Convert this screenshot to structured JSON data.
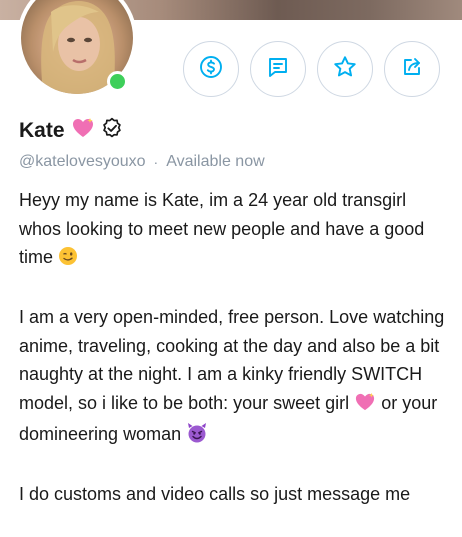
{
  "profile": {
    "name": "Kate",
    "handle": "@katelovesyouxo",
    "separator": "·",
    "availability": "Available now",
    "status_color": "#3ecf5a"
  },
  "actions": [
    {
      "icon": "dollar-tip-icon"
    },
    {
      "icon": "message-icon"
    },
    {
      "icon": "star-icon"
    },
    {
      "icon": "share-icon"
    }
  ],
  "accent_color": "#00aff0",
  "bio": {
    "p1_text": "Heyy my name is Kate, im a 24 year old transgirl whos looking to meet new people and have a good time",
    "p2_text_a": "I am a very open-minded, free person. Love watching anime, traveling, cooking at the day and also be a bit naughty at the night. I am a kinky friendly SWITCH model, so i like to be both: your sweet girl",
    "p2_text_b": "or your domineering woman",
    "p3_text": "I do customs and video calls so just message me"
  }
}
